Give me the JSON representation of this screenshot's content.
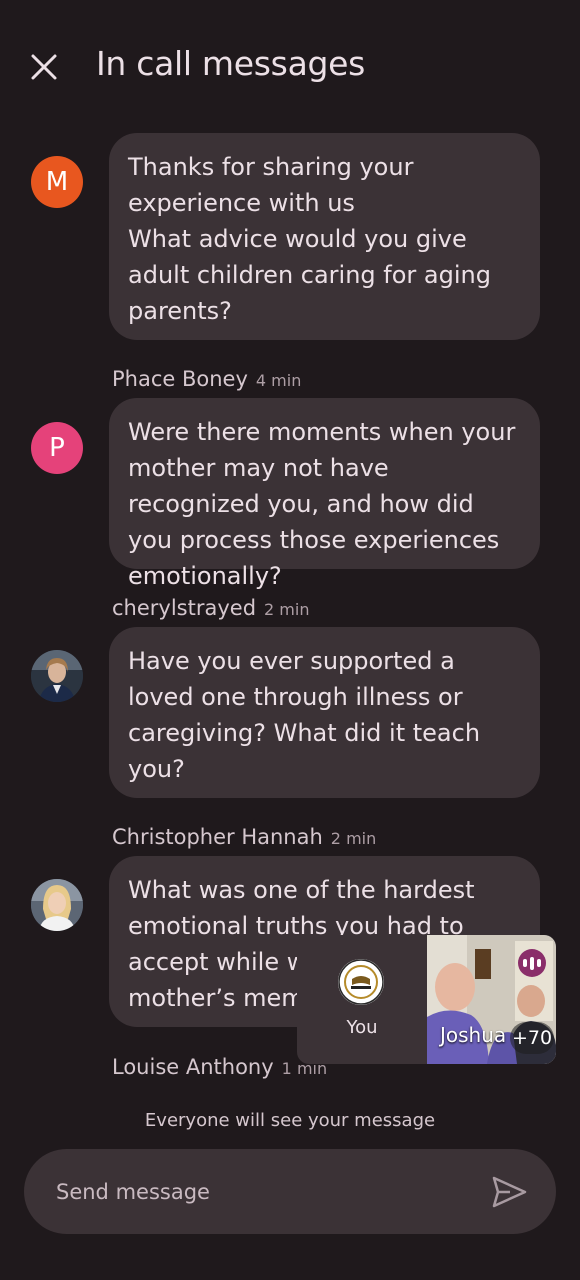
{
  "header": {
    "title": "In call messages",
    "close_icon": "close-icon"
  },
  "messages": [
    {
      "avatar_letter": "M",
      "avatar_color": "#e8571f",
      "lines": [
        "Thanks for sharing your experience with us",
        "What advice would you give adult children caring for aging parents?"
      ]
    },
    {
      "sender": "Phace Boney",
      "time": "4 min",
      "avatar_letter": "P",
      "avatar_color": "#e5427a",
      "lines": [
        "Were there moments when your mother may not have recognized you, and how did you process those experiences emotionally?"
      ]
    },
    {
      "sender": "cherylstrayed",
      "time": "2 min",
      "avatar_icon": "user-photo-avatar",
      "lines": [
        "Have you ever supported a loved one through illness or caregiving? What did it teach you?"
      ]
    },
    {
      "sender": "Christopher Hannah",
      "time": "2 min",
      "avatar_icon": "user-photo-avatar",
      "lines": [
        "What was one of the hardest emotional truths you had to accept while watching your mother’s memory fade?"
      ]
    },
    {
      "sender": "Louise Anthony",
      "time": "1 min"
    }
  ],
  "pip": {
    "self_label": "You",
    "participant_name": "Joshua",
    "extra_count": "+70",
    "speaking_color": "#8a2e6a"
  },
  "notice": "Everyone will see your message",
  "composer": {
    "placeholder": "Send message",
    "value": ""
  },
  "colors": {
    "background": "#1f191c",
    "bubble": "#3b3236",
    "text": "#ece0e6"
  }
}
